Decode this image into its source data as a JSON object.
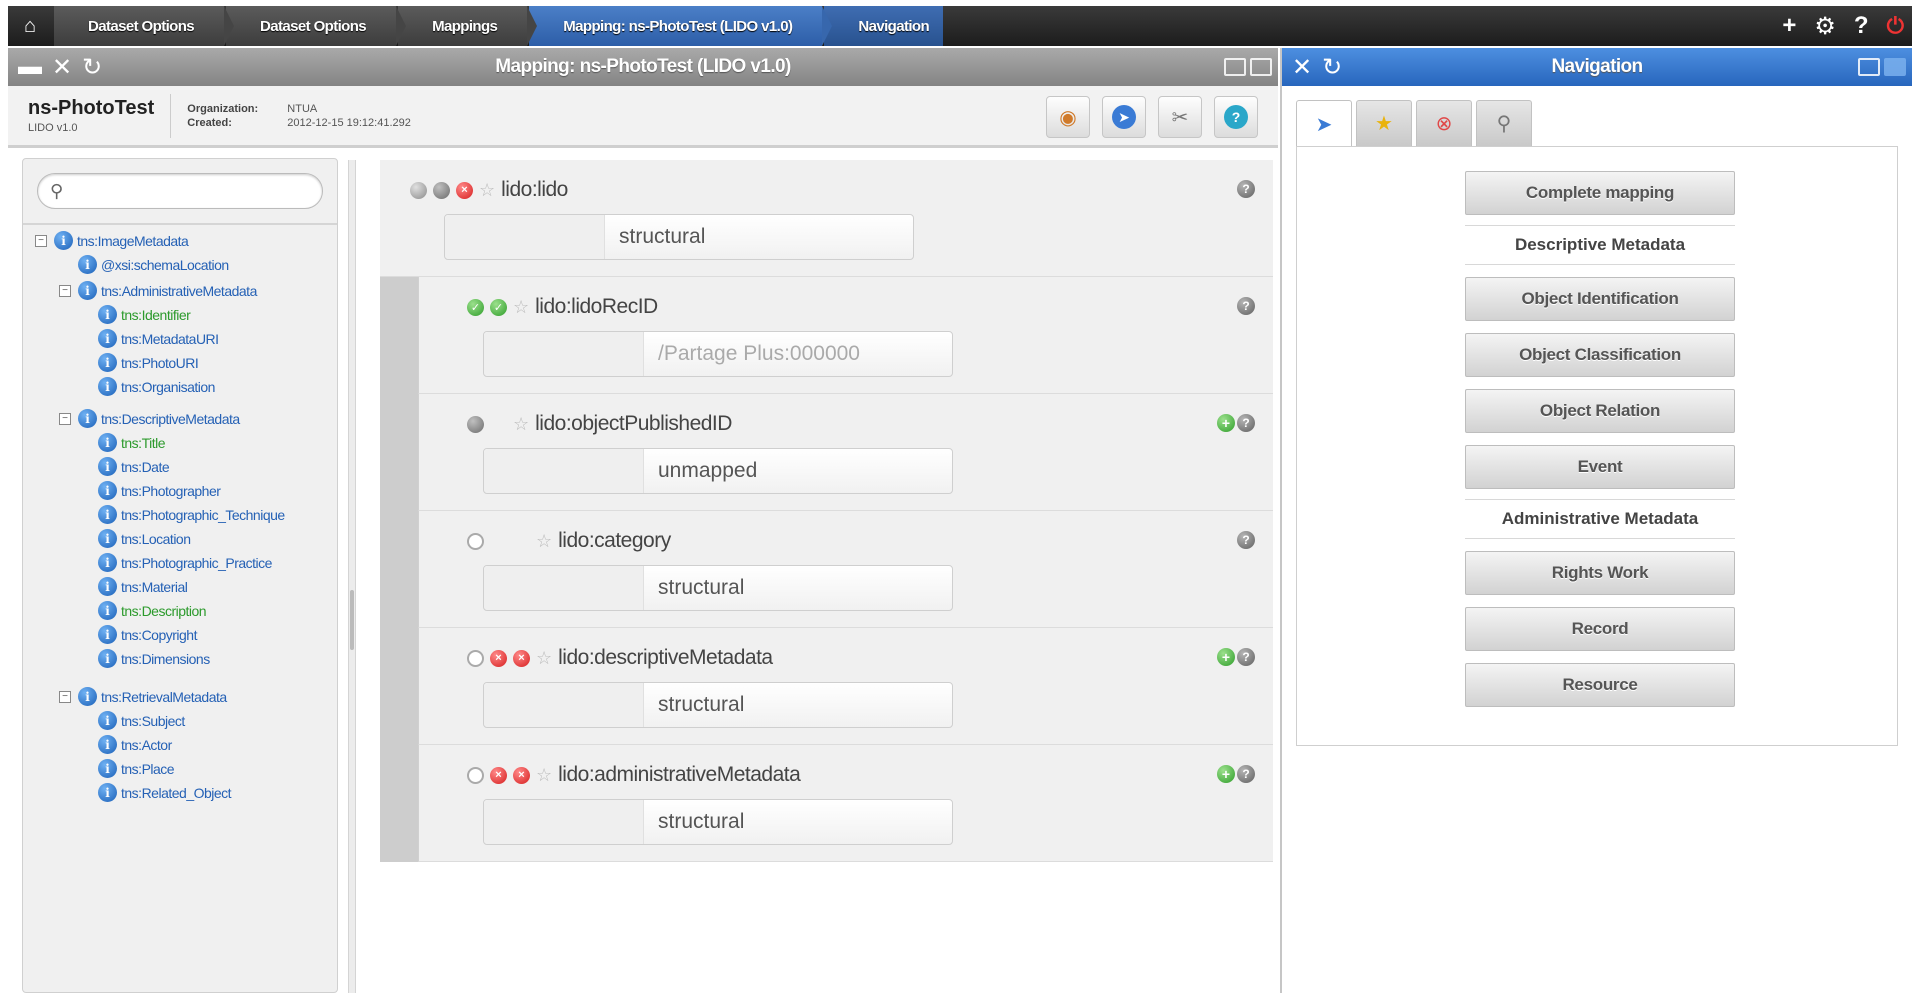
{
  "topbar": {
    "breadcrumbs": [
      "Dataset Options",
      "Dataset Options",
      "Mappings",
      "Mapping: ns-PhotoTest (LIDO v1.0)",
      "Navigation"
    ],
    "icons": [
      "home-icon",
      "plus-icon",
      "gear-icon",
      "help-icon",
      "power-icon"
    ],
    "tools": {
      "plus": "+",
      "gear": "⚙",
      "help": "?",
      "power": "⏻"
    }
  },
  "mapping_panel": {
    "title": "Mapping: ns-PhotoTest (LIDO v1.0)",
    "name": "ns-PhotoTest",
    "schema": "LIDO v1.0",
    "organization_label": "Organization:",
    "organization": "NTUA",
    "created_label": "Created:",
    "created": "2012-12-15 19:12:41.292",
    "search_placeholder": ""
  },
  "tree": [
    {
      "label": "tns:ImageMetadata",
      "level": 0,
      "toggle": "−"
    },
    {
      "label": "@xsi:schemaLocation",
      "level": 1
    },
    {
      "label": "tns:AdministrativeMetadata",
      "level": 1,
      "toggle": "−"
    },
    {
      "label": "tns:Identifier",
      "level": 2,
      "color": "green"
    },
    {
      "label": "tns:MetadataURI",
      "level": 2
    },
    {
      "label": "tns:PhotoURI",
      "level": 2
    },
    {
      "label": "tns:Organisation",
      "level": 2
    },
    {
      "label": "tns:DescriptiveMetadata",
      "level": 1,
      "toggle": "−"
    },
    {
      "label": "tns:Title",
      "level": 2,
      "color": "green"
    },
    {
      "label": "tns:Date",
      "level": 2
    },
    {
      "label": "tns:Photographer",
      "level": 2
    },
    {
      "label": "tns:Photographic_Technique",
      "level": 2
    },
    {
      "label": "tns:Location",
      "level": 2
    },
    {
      "label": "tns:Photographic_Practice",
      "level": 2
    },
    {
      "label": "tns:Material",
      "level": 2
    },
    {
      "label": "tns:Description",
      "level": 2,
      "color": "green"
    },
    {
      "label": "tns:Copyright",
      "level": 2
    },
    {
      "label": "tns:Dimensions",
      "level": 2
    },
    {
      "label": "tns:RetrievalMetadata",
      "level": 1,
      "toggle": "−"
    },
    {
      "label": "tns:Subject",
      "level": 2
    },
    {
      "label": "tns:Actor",
      "level": 2
    },
    {
      "label": "tns:Place",
      "level": 2
    },
    {
      "label": "tns:Related_Object",
      "level": 2
    }
  ],
  "elements": [
    {
      "name": "lido:lido",
      "value": "structural",
      "dots": [
        "grey",
        "dgrey",
        "red"
      ],
      "actions": [
        "help"
      ],
      "child": false
    },
    {
      "name": "lido:lidoRecID",
      "value": "/Partage Plus:000000",
      "dots": [
        "green",
        "green"
      ],
      "actions": [
        "help"
      ],
      "child": true,
      "value_style": "gray"
    },
    {
      "name": "lido:objectPublishedID",
      "value": "unmapped",
      "dots": [
        "dgrey",
        "hole"
      ],
      "actions": [
        "plus",
        "help"
      ],
      "child": true
    },
    {
      "name": "lido:category",
      "value": "structural",
      "dots": [
        "empty",
        "hole",
        "hole"
      ],
      "actions": [
        "help"
      ],
      "child": true
    },
    {
      "name": "lido:descriptiveMetadata",
      "value": "structural",
      "dots": [
        "empty",
        "red",
        "red"
      ],
      "actions": [
        "plus",
        "help"
      ],
      "child": true
    },
    {
      "name": "lido:administrativeMetadata",
      "value": "structural",
      "dots": [
        "empty",
        "red",
        "red"
      ],
      "actions": [
        "plus",
        "help"
      ],
      "child": true
    }
  ],
  "nav_panel": {
    "title": "Navigation",
    "tabs": [
      "compass-icon",
      "star-icon",
      "error-icon",
      "search-icon"
    ],
    "items": [
      {
        "type": "button",
        "label": "Complete mapping"
      },
      {
        "type": "group",
        "label": "Descriptive Metadata"
      },
      {
        "type": "button",
        "label": "Object Identification"
      },
      {
        "type": "button",
        "label": "Object Classification"
      },
      {
        "type": "button",
        "label": "Object Relation"
      },
      {
        "type": "button",
        "label": "Event"
      },
      {
        "type": "group",
        "label": "Administrative Metadata"
      },
      {
        "type": "button",
        "label": "Rights Work"
      },
      {
        "type": "button",
        "label": "Record"
      },
      {
        "type": "button",
        "label": "Resource"
      }
    ]
  },
  "colors": {
    "link": "#2561b5",
    "mapped": "#2c9a2c",
    "nav_header": "#2866bd",
    "error": "#d61e1e"
  }
}
